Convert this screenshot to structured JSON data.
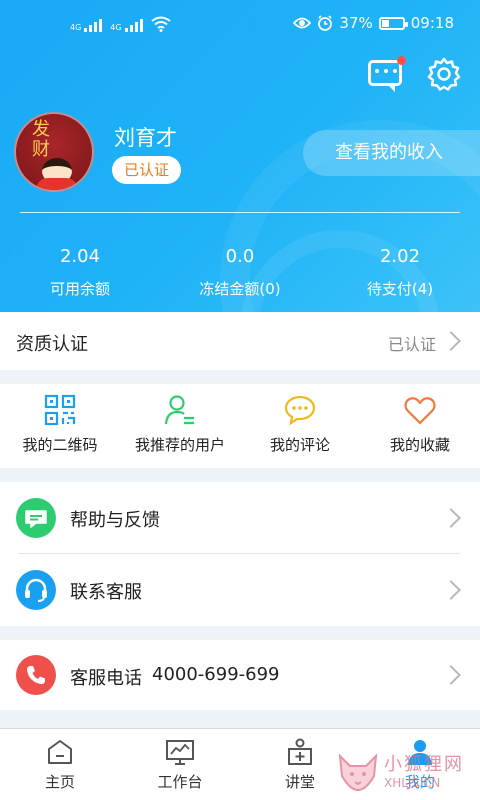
{
  "status_bar": {
    "signal1_tag": "4G",
    "signal2_tag": "4G",
    "battery": "37%",
    "battery_level": 0.37,
    "time": "09:18"
  },
  "header": {
    "message_icon": "message-icon",
    "settings_icon": "gear-icon",
    "has_unread": true
  },
  "profile": {
    "avatar_text": "发财",
    "name": "刘育才",
    "verified_label": "已认证",
    "income_button": "查看我的收入"
  },
  "stats": [
    {
      "value": "2.04",
      "label": "可用余额"
    },
    {
      "value": "0.0",
      "label": "冻结金额(0)"
    },
    {
      "value": "2.02",
      "label": "待支付(4)"
    }
  ],
  "qualification": {
    "title": "资质认证",
    "status": "已认证"
  },
  "quick_actions": [
    {
      "label": "我的二维码",
      "icon": "qr-code-icon"
    },
    {
      "label": "我推荐的用户",
      "icon": "user-list-icon"
    },
    {
      "label": "我的评论",
      "icon": "comment-icon"
    },
    {
      "label": "我的收藏",
      "icon": "heart-icon"
    }
  ],
  "list": [
    {
      "label": "帮助与反馈",
      "icon": "feedback-icon",
      "color": "#2ecc71"
    },
    {
      "label": "联系客服",
      "icon": "headset-icon",
      "color": "#1aa0f0"
    }
  ],
  "phone": {
    "label": "客服电话",
    "number": "4000-699-699",
    "color": "#f0504b"
  },
  "tabbar": [
    {
      "label": "主页",
      "icon": "home-icon"
    },
    {
      "label": "工作台",
      "icon": "chart-icon"
    },
    {
      "label": "讲堂",
      "icon": "classroom-icon"
    },
    {
      "label": "我的",
      "icon": "profile-icon",
      "active": true
    }
  ],
  "watermark": {
    "cn": "小狐狸网",
    "en": "XHLJS.CN"
  },
  "colors": {
    "primary": "#1aa9f5",
    "accent_orange": "#f07a1a",
    "green": "#2ecc71",
    "red": "#f0504b"
  }
}
